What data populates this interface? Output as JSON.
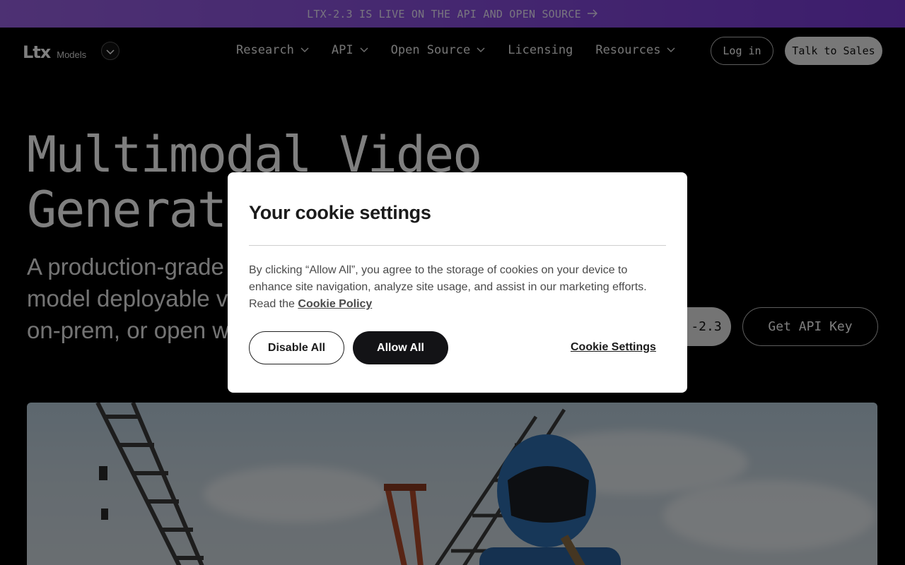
{
  "banner": {
    "text": "LTX-2.3 IS LIVE ON THE API AND OPEN SOURCE",
    "arrow_icon": "arrow-right-icon"
  },
  "header": {
    "logo_text": "Ltx",
    "logo_sub": "Models",
    "nav": [
      {
        "label": "Research",
        "has_dropdown": true
      },
      {
        "label": "API",
        "has_dropdown": true
      },
      {
        "label": "Open Source",
        "has_dropdown": true
      },
      {
        "label": "Licensing",
        "has_dropdown": false
      },
      {
        "label": "Resources",
        "has_dropdown": true
      }
    ],
    "login_label": "Log in",
    "sales_label": "Talk to Sales"
  },
  "hero": {
    "title_line1": "Multimodal Video",
    "title_line2": "Generati",
    "subtitle_line1": "A production-grade",
    "subtitle_line2": "model deployable v",
    "subtitle_line3": "on-prem, or open w",
    "try_label": "-2.3",
    "apikey_label": "Get API Key"
  },
  "cookie_modal": {
    "title": "Your cookie settings",
    "body": "By clicking “Allow All”, you agree to the storage of cookies on your device to enhance site navigation, analyze site usage, and assist in our marketing efforts. Read the ",
    "policy_link": "Cookie Policy",
    "disable_label": "Disable All",
    "allow_label": "Allow All",
    "settings_label": "Cookie Settings"
  },
  "colors": {
    "banner_start": "#9b62e6",
    "banner_end": "#7a3bd9",
    "page_bg": "#000000",
    "modal_bg": "#ffffff",
    "allow_button_bg": "#131316"
  }
}
